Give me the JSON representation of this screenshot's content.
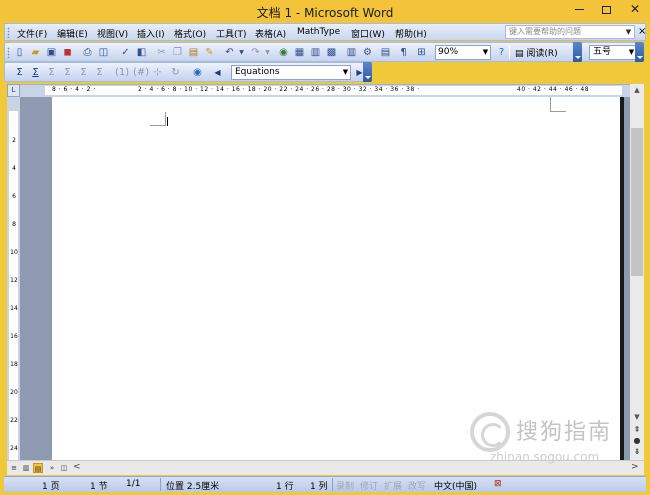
{
  "window": {
    "title": "文档 1 - Microsoft Word",
    "close_glyph": "✕"
  },
  "menubar": {
    "items": [
      "文件(F)",
      "编辑(E)",
      "视图(V)",
      "插入(I)",
      "格式(O)",
      "工具(T)",
      "表格(A)",
      "MathType",
      "窗口(W)",
      "帮助(H)"
    ],
    "help_placeholder": "键入需要帮助的问题",
    "doc_close_glyph": "×"
  },
  "toolbar_standard": {
    "zoom": "90%",
    "read_label": "阅读(R)",
    "font_size": "五号"
  },
  "toolbar_mathtype": {
    "equations_label": "Equations"
  },
  "ruler": {
    "top_left_marks": "8 · 6 · 4 · 2 ·",
    "top_marks": "2 · 4 · 6 · 8 · 10 · 12 · 14 · 16 · 18 · 20 · 22 · 24 · 26 · 28 · 30 · 32 · 34 · 36 · 38 ·",
    "top_right_marks": "40 · 42 · 44 · 46 · 48",
    "left_marks": [
      "2",
      "4",
      "6",
      "8",
      "10",
      "12",
      "14",
      "16",
      "18",
      "20",
      "22",
      "24"
    ]
  },
  "statusbar": {
    "page": "1 页",
    "section": "1 节",
    "page_of": "1/1",
    "position": "位置 2.5厘米",
    "line": "1 行",
    "column": "1 列",
    "rec": "录制",
    "trk": "修订",
    "ext": "扩展",
    "ovr": "改写",
    "language": "中文(中国)"
  },
  "watermark": {
    "brand_cn": "搜狗指南",
    "url": "zhinan.sogou.com"
  },
  "colors": {
    "title_bar": "#f3c43a",
    "toolbar": "#c4d3ee",
    "workspace": "#8e9ab0"
  }
}
